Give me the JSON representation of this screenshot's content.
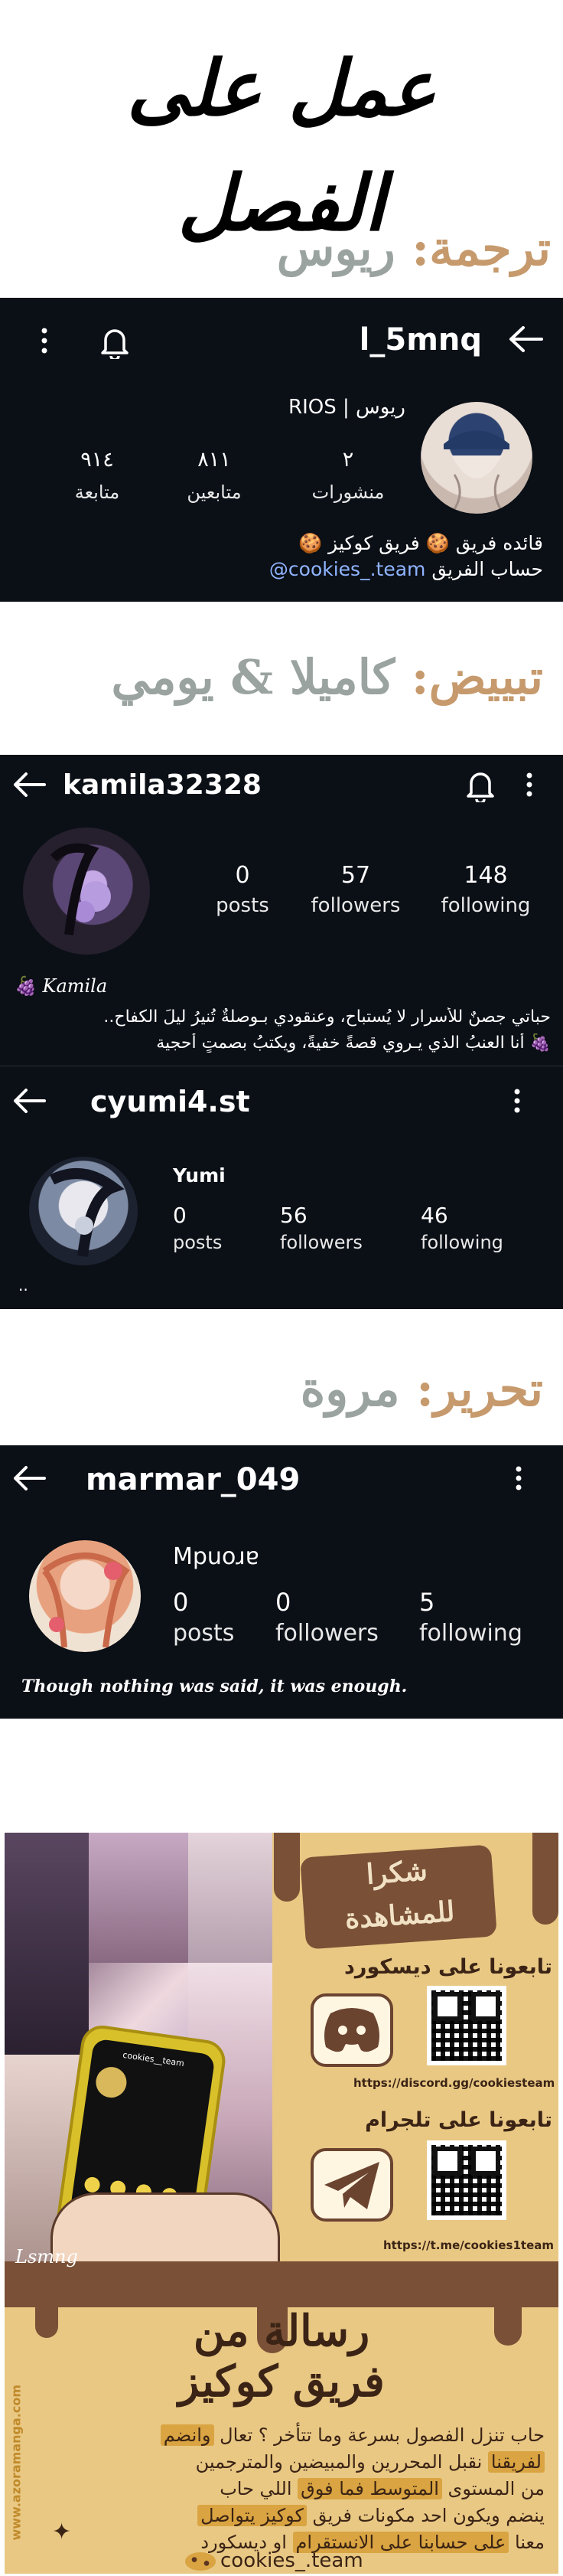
{
  "titles": {
    "main": "عمل على الفصل",
    "translation_label": "ترجمة",
    "translation_name": "ريوس",
    "coloring_label": "تبييض",
    "coloring_names": "كاميلا & يومي",
    "editing_label": "تحرير",
    "editing_name": "مروة"
  },
  "profile1": {
    "username": "l_5mnq",
    "display_name": "ريوس | RIOS",
    "posts_count": "٢",
    "posts_label": "منشورات",
    "followers_count": "٨١١",
    "followers_label": "متابعين",
    "following_count": "٩١٤",
    "following_label": "متابعة",
    "bio_line1": "قائده فريق 🍪 فريق كوكيز 🍪",
    "bio_line2_prefix": "حساب الفريق",
    "bio_line2_link": "cookies_.team@"
  },
  "profile2": {
    "username": "kamila32328",
    "posts_count": "0",
    "posts_label": "posts",
    "followers_count": "57",
    "followers_label": "followers",
    "following_count": "148",
    "following_label": "following",
    "name": "🍇 Kamila",
    "bio_line1": "حباتي جصنٌ للأسرار لا يُستباح، وعنقودي بـوصلةٌ تُنيرُ ليلَ الكفاح..",
    "bio_line2": "🍇 أنا العنبُ الذي يـروي قصةً خفيةً، ويكتبُ بصمتٍ أحجية"
  },
  "profile3": {
    "username": "cyumi4.st",
    "name": "Yumi",
    "posts_count": "0",
    "posts_label": "posts",
    "followers_count": "56",
    "followers_label": "followers",
    "following_count": "46",
    "following_label": "following",
    "bio": ".."
  },
  "profile4": {
    "username": "marmar_049",
    "name": "Mpuoɹɐ",
    "posts_count": "0",
    "posts_label": "posts",
    "followers_count": "0",
    "followers_label": "followers",
    "following_count": "5",
    "following_label": "following",
    "bio": "Though nothing was said, it was enough."
  },
  "poster": {
    "thanks_line1": "شكرا",
    "thanks_line2": "للمشاهدة",
    "discord_label": "تابعونا على ديسكورد",
    "discord_link": "https://discord.gg/cookiesteam",
    "telegram_label": "تابعونا على تلجرام",
    "telegram_link": "https://t.me/cookies1team",
    "phone_header": "cookies__team",
    "message_title1": "رسالة من",
    "message_title2": "فريق كوكيز",
    "message_line1_a": "حاب تنزل الفصول بسرعة وما تتأخر ؟ تعال ",
    "message_line1_hl": "وانضم",
    "message_line2_hl": "لفريقنا",
    "message_line2_b": " نقبل المحررين والمبيضين والمترجمين",
    "message_line3_a": "من المستوى ",
    "message_line3_hl": "المتوسط فما فوق",
    "message_line3_b": " اللي حاب",
    "message_line4_a": "ينضم ويكون احد مكونات فريق ",
    "message_line4_hl": "كوكيز يتواصل",
    "message_line5_a": "معنا ",
    "message_line5_hl": "على حسابنا على الانستقرام",
    "message_line5_b": " او ديسكورد",
    "account": "cookies_.team",
    "watermark": "www.azoramanga.com",
    "signature": "Lsmng"
  },
  "colors": {
    "panel_bg": "#0b0f16",
    "title_tan": "#c69a6d",
    "title_gray": "#9aa3a0",
    "link_blue": "#8fb4ff",
    "poster_bg": "#e9c884",
    "poster_brown": "#7a5036"
  }
}
